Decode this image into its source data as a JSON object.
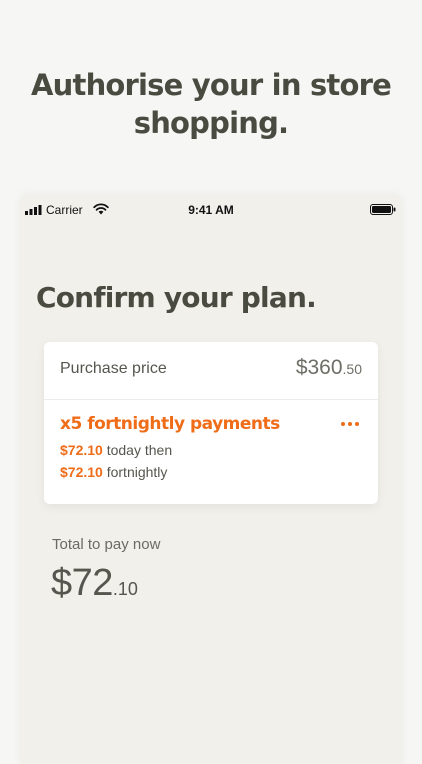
{
  "headline": {
    "line1": "Authorise your in store",
    "line2": "shopping."
  },
  "status_bar": {
    "carrier": "Carrier",
    "time": "9:41 AM",
    "icons": [
      "signal-icon",
      "wifi-icon",
      "battery-icon"
    ]
  },
  "screen": {
    "title": "Confirm your plan.",
    "card": {
      "purchase_label": "Purchase price",
      "purchase_dollars": "$360",
      "purchase_cents": ".50",
      "plan_heading": "x5 fortnightly payments",
      "more_icon": "more-icon",
      "line1_amount": "$72.10",
      "line1_text": " today then",
      "line2_amount": "$72.10",
      "line2_text": " fortnightly"
    },
    "total_label": "Total to pay now",
    "total_dollars": "$72",
    "total_cents": ".10"
  },
  "colors": {
    "accent": "#ef6c19",
    "text_dark": "#4a4b40",
    "background": "#f6f6f4",
    "phone_background": "#f1f0eb"
  }
}
